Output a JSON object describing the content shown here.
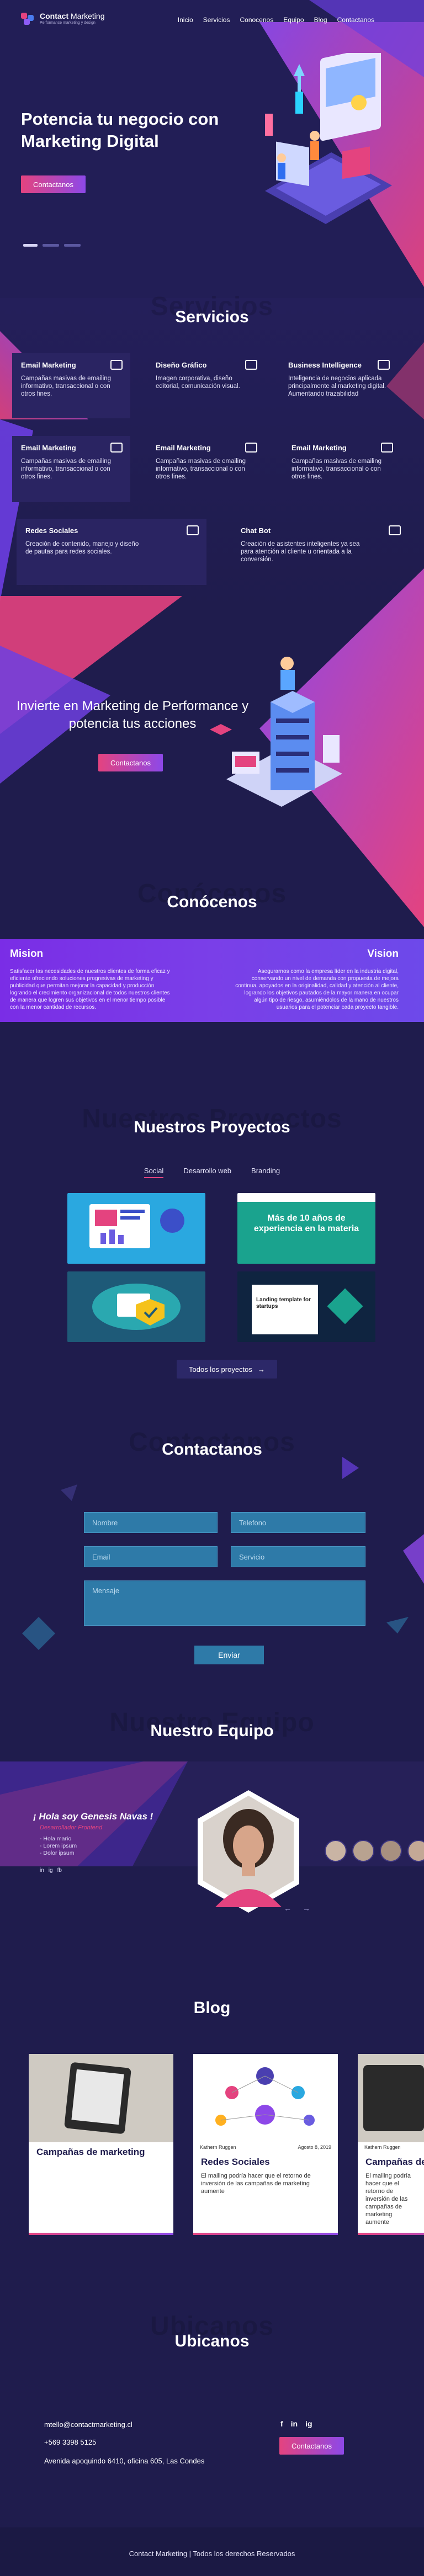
{
  "brand": {
    "name_bold": "Contact",
    "name_light": "Marketing",
    "tagline": "Performance marketing y design",
    "colors": {
      "bg": "#1f1c4d",
      "pink": "#e4437f",
      "purple": "#8d48e8",
      "blue": "#2e7aa8"
    }
  },
  "nav": {
    "items": [
      "Inicio",
      "Servicios",
      "Conocenos",
      "Equipo",
      "Blog",
      "Contactanos"
    ]
  },
  "hero": {
    "title": "Potencia tu negocio con Marketing Digital",
    "button": "Contactanos",
    "slides": 3,
    "active_slide": 1
  },
  "servicios": {
    "title": "Servicios",
    "ghost": "Servicios",
    "items": [
      {
        "title": "Email Marketing",
        "desc": "Campañas masivas de emailing informativo, transaccional o con otros fines.",
        "icon": "email-icon"
      },
      {
        "title": "Diseño Gráfico",
        "desc": "Imagen corporativa, diseño editorial, comunicación visual.",
        "icon": "cube-icon"
      },
      {
        "title": "Business Intelligence",
        "desc": "Inteligencia de negocios aplicada principalmente al marketing digital. Aumentando trazabilidad",
        "icon": "bi-icon"
      },
      {
        "title": "Email Marketing",
        "desc": "Campañas masivas de emailing informativo, transaccional o con otros fines.",
        "icon": "email-icon"
      },
      {
        "title": "Email Marketing",
        "desc": "Campañas masivas de emailing informativo, transaccional o con otros fines.",
        "icon": "share-icon"
      },
      {
        "title": "Email Marketing",
        "desc": "Campañas masivas de emailing informativo, transaccional o con otros fines.",
        "icon": "share-icon"
      },
      {
        "title": "Redes Sociales",
        "desc": "Creación de contenido, manejo y diseño de pautas para redes sociales.",
        "icon": "share-icon"
      },
      {
        "title": "Chat Bot",
        "desc": "Creación de asistentes inteligentes ya sea para atención al cliente u orientada a la conversión.",
        "icon": "chat-icon"
      }
    ]
  },
  "cta": {
    "text": "Invierte en Marketing de Performance y potencia tus acciones",
    "button": "Contactanos"
  },
  "conocenos": {
    "title": "Conócenos",
    "ghost": "Conócenos",
    "mision_title": "Mision",
    "mision_text": "Satisfacer las necesidades de nuestros clientes de forma eficaz y eficiente ofreciendo soluciones progresivas de marketing y publicidad que permitan mejorar la capacidad y producción logrando el crecimiento organizacional de todos nuestros clientes de manera que logren sus objetivos en el menor tiempo posible con la menor cantidad de recursos.",
    "vision_title": "Vision",
    "vision_text": "Asegurarnos como la empresa líder en la industria digital, conservando un nivel de demanda con propuesta de mejora continua, apoyados en la originalidad, calidad y atención al cliente, logrando los objetivos pautados de la mayor manera en ocupar algún tipo de riesgo, asumiéndolos de la mano de nuestros usuarios para el potenciar cada proyecto tangible."
  },
  "proyectos": {
    "title": "Nuestros Proyectos",
    "ghost": "Nuestros Proyectos",
    "tabs": [
      "Social",
      "Desarrollo web",
      "Branding"
    ],
    "active_tab": "Social",
    "banner_text": "Más de 10 años de experiencia en la materia",
    "landing_text": "Landing template for startups",
    "button": "Todos los proyectos"
  },
  "contacto": {
    "title": "Contactanos",
    "ghost": "Contactanos",
    "name_placeholder": "Nombre",
    "phone_placeholder": "Telefono",
    "email_placeholder": "Email",
    "service_placeholder": "Servicio",
    "message_placeholder": "Mensaje",
    "submit": "Enviar"
  },
  "equipo": {
    "title": "Nuestro Equipo",
    "ghost": "Nuestro Equipo",
    "greeting": "¡ Hola soy Genesis Navas !",
    "role": "Desarrollador Frontend",
    "list": [
      "Hola mario",
      "Lorem ipsum",
      "Dolor ipsum"
    ],
    "social": [
      "in",
      "ig",
      "fb"
    ],
    "prev": "←",
    "next": "→"
  },
  "blog": {
    "title": "Blog",
    "posts": [
      {
        "title": "Campañas de marketing",
        "author": "",
        "date": "",
        "desc": ""
      },
      {
        "title": "Redes Sociales",
        "author": "Kathern Ruggen",
        "date": "Agosto 8, 2019",
        "desc": "El mailing podría hacer que el retorno de inversión de las campañas de marketing aumente"
      },
      {
        "title": "Campañas de",
        "author": "Kathern Ruggen",
        "date": "",
        "desc": "El mailing podría hacer que el retorno de inversión de las campañas de marketing aumente"
      }
    ]
  },
  "ubicanos": {
    "title": "Ubicanos",
    "ghost": "Ubicanos",
    "email": "mtello@contactmarketing.cl",
    "phone": "+569 3398 5125",
    "address": "Avenida apoquindo 6410, oficina 605, Las Condes",
    "button": "Contactanos",
    "social": [
      "f",
      "in",
      "ig"
    ]
  },
  "footer": {
    "text": "Contact Marketing | Todos los derechos Reservados"
  }
}
